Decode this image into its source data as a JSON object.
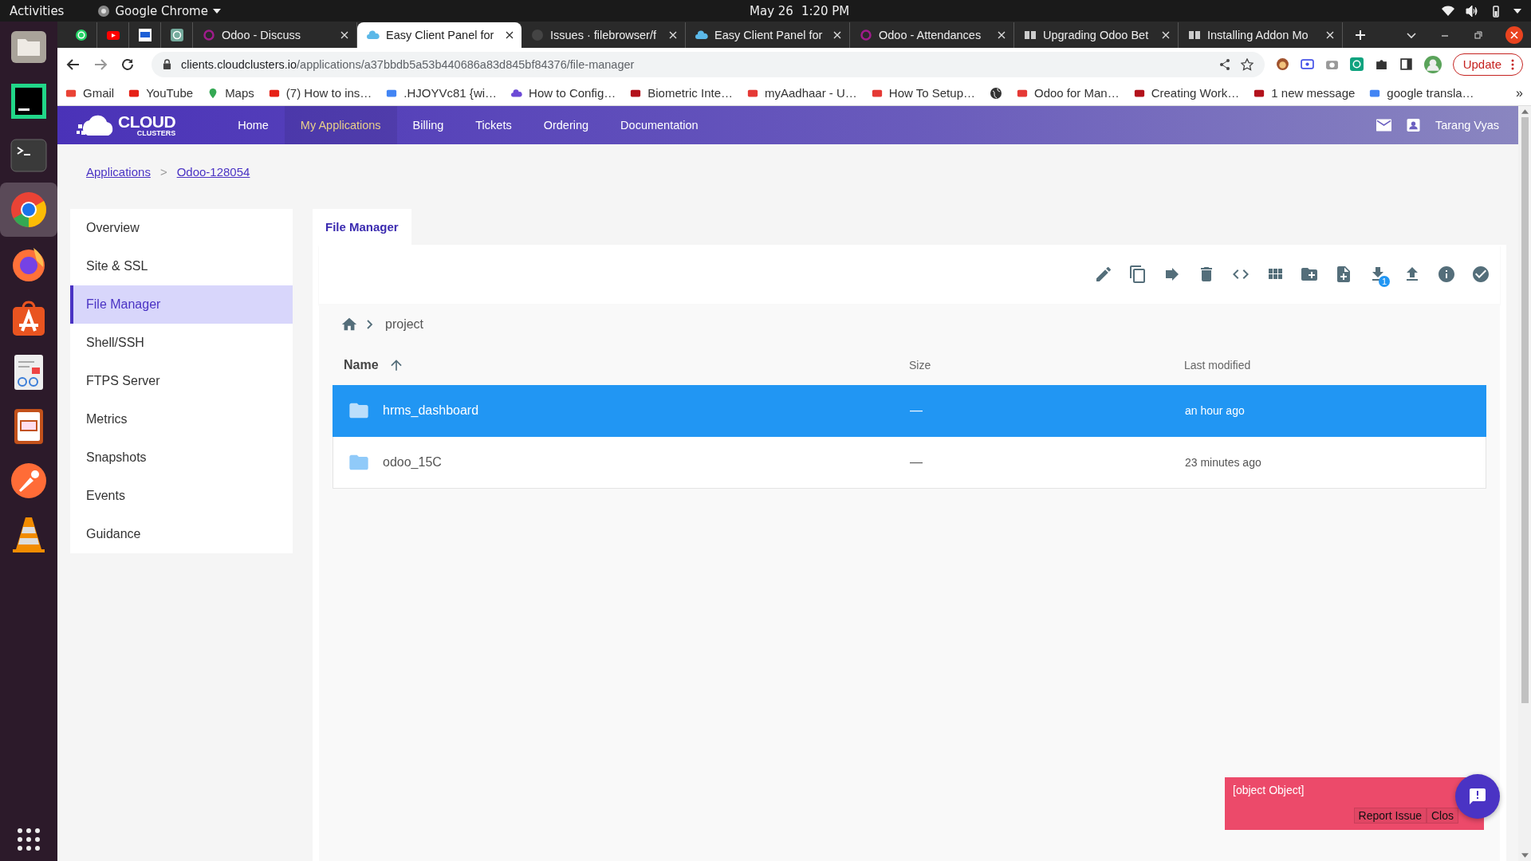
{
  "system_bar": {
    "activities": "Activities",
    "app_menu": "Google Chrome",
    "date": "May 26",
    "time": "1:20 PM"
  },
  "browser": {
    "tabs": [
      {
        "label": "Odoo - Discuss",
        "selected": false
      },
      {
        "label": "Easy Client Panel for",
        "selected": true
      },
      {
        "label": "Issues · filebrowser/f",
        "selected": false
      },
      {
        "label": "Easy Client Panel for",
        "selected": false
      },
      {
        "label": "Odoo - Attendances",
        "selected": false
      },
      {
        "label": "Upgrading Odoo Bet",
        "selected": false
      },
      {
        "label": "Installing Addon Mo",
        "selected": false
      }
    ],
    "url_host": "clients.cloudclusters.io",
    "url_path": "/applications/a37bbdb5a53b440686a83d845bf84376/file-manager",
    "update_button": "Update",
    "bookmarks": [
      "Gmail",
      "YouTube",
      "Maps",
      "(7) How to ins…",
      ".HJOYVc81 {wi…",
      "How to Config…",
      "Biometric Inte…",
      "myAadhaar - U…",
      "How To Setup…",
      "Odoo for Man…",
      "Creating Work…",
      "1 new message",
      "google transla…"
    ],
    "more_bookmarks": "»"
  },
  "site_nav": {
    "logo_top": "CLOUD",
    "logo_bottom": "CLUSTERS",
    "items": [
      {
        "label": "Home",
        "selected": false
      },
      {
        "label": "My Applications",
        "selected": true
      },
      {
        "label": "Billing",
        "selected": false
      },
      {
        "label": "Tickets",
        "selected": false
      },
      {
        "label": "Ordering",
        "selected": false
      },
      {
        "label": "Documentation",
        "selected": false
      }
    ],
    "user": "Tarang Vyas"
  },
  "breadcrumb": {
    "items": [
      "Applications",
      "Odoo-128054"
    ],
    "separator": ">"
  },
  "sidebar": {
    "items": [
      {
        "label": "Overview",
        "selected": false
      },
      {
        "label": "Site & SSL",
        "selected": false
      },
      {
        "label": "File Manager",
        "selected": true
      },
      {
        "label": "Shell/SSH",
        "selected": false
      },
      {
        "label": "FTPS Server",
        "selected": false
      },
      {
        "label": "Metrics",
        "selected": false
      },
      {
        "label": "Snapshots",
        "selected": false
      },
      {
        "label": "Events",
        "selected": false
      },
      {
        "label": "Guidance",
        "selected": false
      }
    ]
  },
  "main": {
    "tabs": [
      {
        "label": "File Manager",
        "selected": true
      }
    ],
    "download_badge": "1",
    "path": [
      "project"
    ],
    "table": {
      "columns": [
        "Name",
        "Size",
        "Last modified"
      ],
      "rows": [
        {
          "name": "hrms_dashboard",
          "size": "—",
          "modified": "an hour ago",
          "selected": true
        },
        {
          "name": "odoo_15C",
          "size": "—",
          "modified": "23 minutes ago",
          "selected": false
        }
      ]
    }
  },
  "toast": {
    "message": "[object Object]",
    "buttons": [
      "Report Issue",
      "Clos"
    ]
  }
}
